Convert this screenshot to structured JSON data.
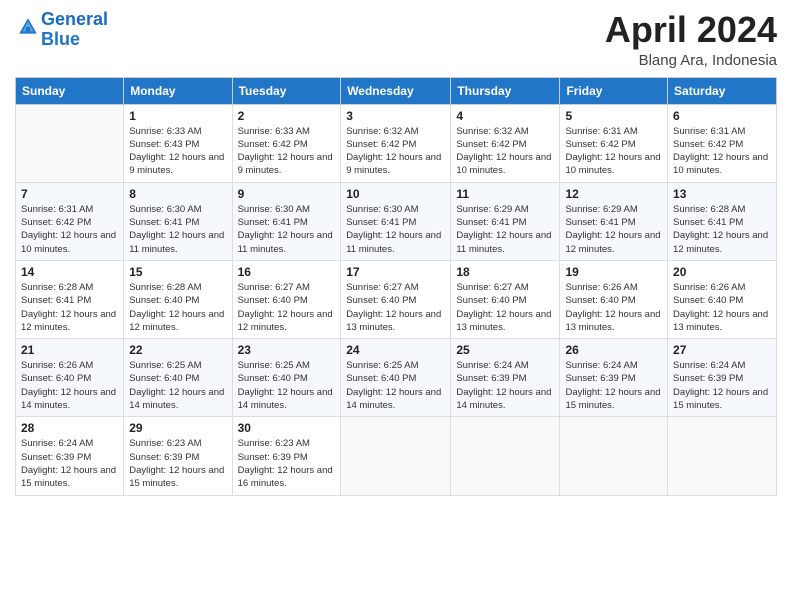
{
  "header": {
    "logo_line1": "General",
    "logo_line2": "Blue",
    "month_year": "April 2024",
    "location": "Blang Ara, Indonesia"
  },
  "weekdays": [
    "Sunday",
    "Monday",
    "Tuesday",
    "Wednesday",
    "Thursday",
    "Friday",
    "Saturday"
  ],
  "weeks": [
    [
      {
        "day": "",
        "sunrise": "",
        "sunset": "",
        "daylight": ""
      },
      {
        "day": "1",
        "sunrise": "Sunrise: 6:33 AM",
        "sunset": "Sunset: 6:43 PM",
        "daylight": "Daylight: 12 hours and 9 minutes."
      },
      {
        "day": "2",
        "sunrise": "Sunrise: 6:33 AM",
        "sunset": "Sunset: 6:42 PM",
        "daylight": "Daylight: 12 hours and 9 minutes."
      },
      {
        "day": "3",
        "sunrise": "Sunrise: 6:32 AM",
        "sunset": "Sunset: 6:42 PM",
        "daylight": "Daylight: 12 hours and 9 minutes."
      },
      {
        "day": "4",
        "sunrise": "Sunrise: 6:32 AM",
        "sunset": "Sunset: 6:42 PM",
        "daylight": "Daylight: 12 hours and 10 minutes."
      },
      {
        "day": "5",
        "sunrise": "Sunrise: 6:31 AM",
        "sunset": "Sunset: 6:42 PM",
        "daylight": "Daylight: 12 hours and 10 minutes."
      },
      {
        "day": "6",
        "sunrise": "Sunrise: 6:31 AM",
        "sunset": "Sunset: 6:42 PM",
        "daylight": "Daylight: 12 hours and 10 minutes."
      }
    ],
    [
      {
        "day": "7",
        "sunrise": "Sunrise: 6:31 AM",
        "sunset": "Sunset: 6:42 PM",
        "daylight": "Daylight: 12 hours and 10 minutes."
      },
      {
        "day": "8",
        "sunrise": "Sunrise: 6:30 AM",
        "sunset": "Sunset: 6:41 PM",
        "daylight": "Daylight: 12 hours and 11 minutes."
      },
      {
        "day": "9",
        "sunrise": "Sunrise: 6:30 AM",
        "sunset": "Sunset: 6:41 PM",
        "daylight": "Daylight: 12 hours and 11 minutes."
      },
      {
        "day": "10",
        "sunrise": "Sunrise: 6:30 AM",
        "sunset": "Sunset: 6:41 PM",
        "daylight": "Daylight: 12 hours and 11 minutes."
      },
      {
        "day": "11",
        "sunrise": "Sunrise: 6:29 AM",
        "sunset": "Sunset: 6:41 PM",
        "daylight": "Daylight: 12 hours and 11 minutes."
      },
      {
        "day": "12",
        "sunrise": "Sunrise: 6:29 AM",
        "sunset": "Sunset: 6:41 PM",
        "daylight": "Daylight: 12 hours and 12 minutes."
      },
      {
        "day": "13",
        "sunrise": "Sunrise: 6:28 AM",
        "sunset": "Sunset: 6:41 PM",
        "daylight": "Daylight: 12 hours and 12 minutes."
      }
    ],
    [
      {
        "day": "14",
        "sunrise": "Sunrise: 6:28 AM",
        "sunset": "Sunset: 6:41 PM",
        "daylight": "Daylight: 12 hours and 12 minutes."
      },
      {
        "day": "15",
        "sunrise": "Sunrise: 6:28 AM",
        "sunset": "Sunset: 6:40 PM",
        "daylight": "Daylight: 12 hours and 12 minutes."
      },
      {
        "day": "16",
        "sunrise": "Sunrise: 6:27 AM",
        "sunset": "Sunset: 6:40 PM",
        "daylight": "Daylight: 12 hours and 12 minutes."
      },
      {
        "day": "17",
        "sunrise": "Sunrise: 6:27 AM",
        "sunset": "Sunset: 6:40 PM",
        "daylight": "Daylight: 12 hours and 13 minutes."
      },
      {
        "day": "18",
        "sunrise": "Sunrise: 6:27 AM",
        "sunset": "Sunset: 6:40 PM",
        "daylight": "Daylight: 12 hours and 13 minutes."
      },
      {
        "day": "19",
        "sunrise": "Sunrise: 6:26 AM",
        "sunset": "Sunset: 6:40 PM",
        "daylight": "Daylight: 12 hours and 13 minutes."
      },
      {
        "day": "20",
        "sunrise": "Sunrise: 6:26 AM",
        "sunset": "Sunset: 6:40 PM",
        "daylight": "Daylight: 12 hours and 13 minutes."
      }
    ],
    [
      {
        "day": "21",
        "sunrise": "Sunrise: 6:26 AM",
        "sunset": "Sunset: 6:40 PM",
        "daylight": "Daylight: 12 hours and 14 minutes."
      },
      {
        "day": "22",
        "sunrise": "Sunrise: 6:25 AM",
        "sunset": "Sunset: 6:40 PM",
        "daylight": "Daylight: 12 hours and 14 minutes."
      },
      {
        "day": "23",
        "sunrise": "Sunrise: 6:25 AM",
        "sunset": "Sunset: 6:40 PM",
        "daylight": "Daylight: 12 hours and 14 minutes."
      },
      {
        "day": "24",
        "sunrise": "Sunrise: 6:25 AM",
        "sunset": "Sunset: 6:40 PM",
        "daylight": "Daylight: 12 hours and 14 minutes."
      },
      {
        "day": "25",
        "sunrise": "Sunrise: 6:24 AM",
        "sunset": "Sunset: 6:39 PM",
        "daylight": "Daylight: 12 hours and 14 minutes."
      },
      {
        "day": "26",
        "sunrise": "Sunrise: 6:24 AM",
        "sunset": "Sunset: 6:39 PM",
        "daylight": "Daylight: 12 hours and 15 minutes."
      },
      {
        "day": "27",
        "sunrise": "Sunrise: 6:24 AM",
        "sunset": "Sunset: 6:39 PM",
        "daylight": "Daylight: 12 hours and 15 minutes."
      }
    ],
    [
      {
        "day": "28",
        "sunrise": "Sunrise: 6:24 AM",
        "sunset": "Sunset: 6:39 PM",
        "daylight": "Daylight: 12 hours and 15 minutes."
      },
      {
        "day": "29",
        "sunrise": "Sunrise: 6:23 AM",
        "sunset": "Sunset: 6:39 PM",
        "daylight": "Daylight: 12 hours and 15 minutes."
      },
      {
        "day": "30",
        "sunrise": "Sunrise: 6:23 AM",
        "sunset": "Sunset: 6:39 PM",
        "daylight": "Daylight: 12 hours and 16 minutes."
      },
      {
        "day": "",
        "sunrise": "",
        "sunset": "",
        "daylight": ""
      },
      {
        "day": "",
        "sunrise": "",
        "sunset": "",
        "daylight": ""
      },
      {
        "day": "",
        "sunrise": "",
        "sunset": "",
        "daylight": ""
      },
      {
        "day": "",
        "sunrise": "",
        "sunset": "",
        "daylight": ""
      }
    ]
  ]
}
